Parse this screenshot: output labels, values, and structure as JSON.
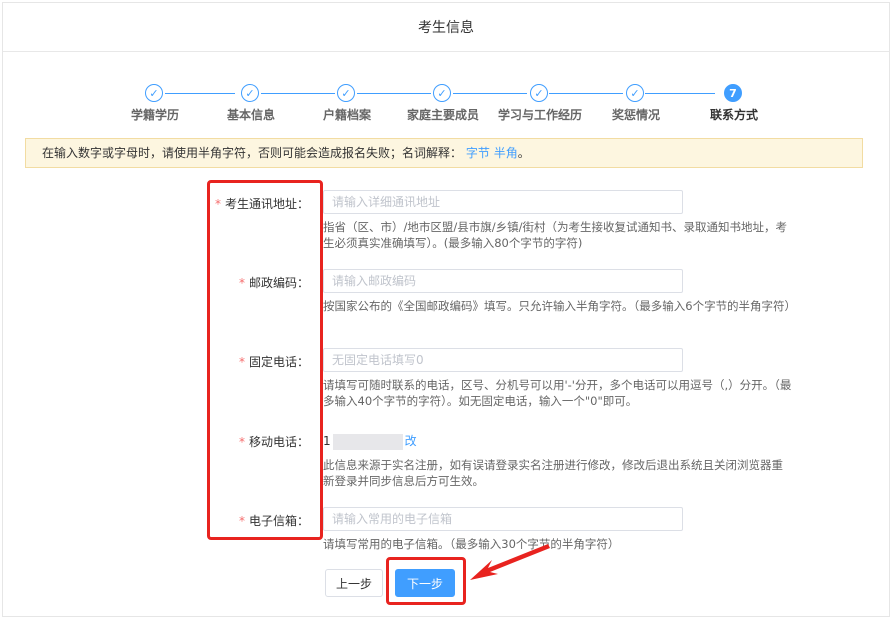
{
  "page": {
    "title": "考生信息"
  },
  "steps": [
    {
      "label": "学籍学历",
      "status": "done"
    },
    {
      "label": "基本信息",
      "status": "done"
    },
    {
      "label": "户籍档案",
      "status": "done"
    },
    {
      "label": "家庭主要成员",
      "status": "done"
    },
    {
      "label": "学习与工作经历",
      "status": "done"
    },
    {
      "label": "奖惩情况",
      "status": "done"
    },
    {
      "label": "联系方式",
      "status": "active",
      "number": "7"
    }
  ],
  "notice": {
    "text": "在输入数字或字母时，请使用半角字符，否则可能会造成报名失败；名词解释：",
    "link1": "字节",
    "link2": "半角",
    "end": "。"
  },
  "form": {
    "address": {
      "label": "考生通讯地址：",
      "placeholder": "请输入详细通讯地址",
      "hint": "指省（区、市）/地市区盟/县市旗/乡镇/街村（为考生接收复试通知书、录取通知书地址，考生必须真实准确填写）。(最多输入80个字节的字符)"
    },
    "postcode": {
      "label": "邮政编码：",
      "placeholder": "请输入邮政编码",
      "hint": "按国家公布的《全国邮政编码》填写。只允许输入半角字符。（最多输入6个字节的半角字符）"
    },
    "landline": {
      "label": "固定电话：",
      "placeholder": "无固定电话填写0",
      "hint": "请填写可随时联系的电话，区号、分机号可以用'-'分开，多个电话可以用逗号（,）分开。（最多输入40个字节的字符）。如无固定电话，输入一个\"0\"即可。"
    },
    "mobile": {
      "label": "移动电话：",
      "value_prefix": "1",
      "link": "改",
      "hint": "此信息来源于实名注册，如有误请登录实名注册进行修改，修改后退出系统且关闭浏览器重新登录并同步信息后方可生效。"
    },
    "email": {
      "label": "电子信箱：",
      "placeholder": "请输入常用的电子信箱",
      "hint": "请填写常用的电子信箱。（最多输入30个字节的半角字符）"
    },
    "required_mark": "*"
  },
  "buttons": {
    "prev": "上一步",
    "next": "下一步"
  },
  "colors": {
    "primary": "#409eff",
    "annotation_red": "#e8231f",
    "required": "#f56c6c"
  }
}
